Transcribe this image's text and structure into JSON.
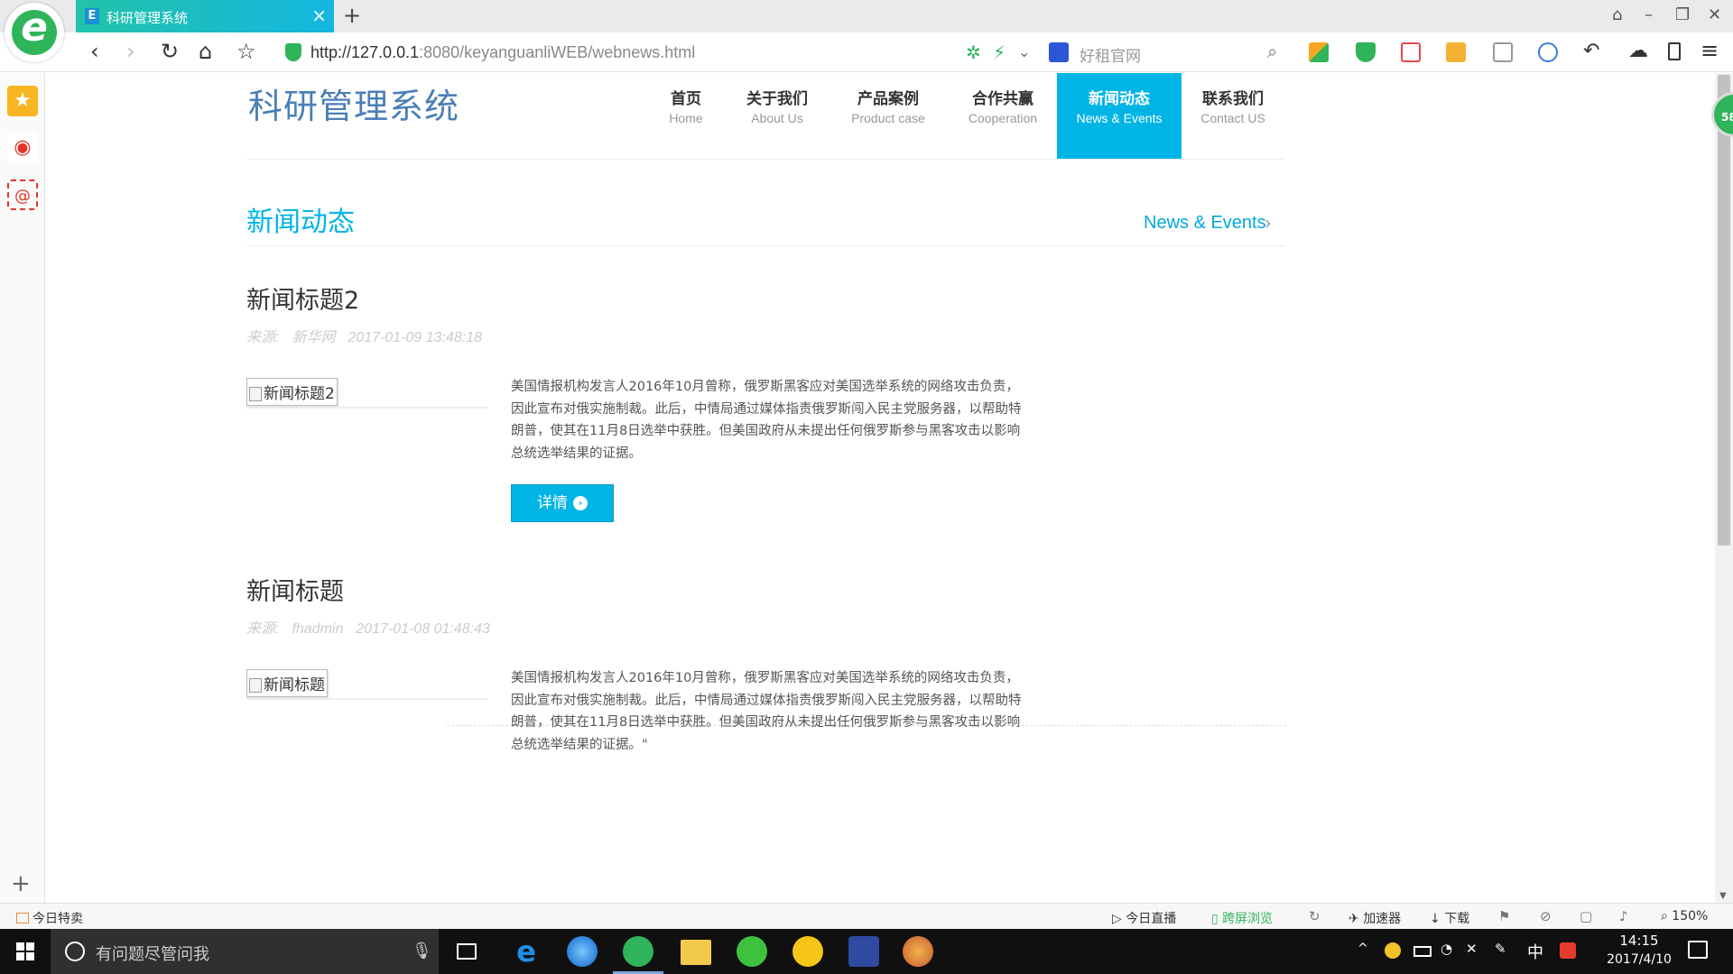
{
  "browser": {
    "tab_title": "科研管理系统",
    "tab_favicon": "E",
    "url_host": "http://127.0.0.1",
    "url_rest": ":8080/keyanguanliWEB/webnews.html",
    "search_placeholder": "好租官网"
  },
  "site": {
    "title": "科研管理系统",
    "nav": [
      {
        "cn": "首页",
        "en": "Home"
      },
      {
        "cn": "关于我们",
        "en": "About Us"
      },
      {
        "cn": "产品案例",
        "en": "Product case"
      },
      {
        "cn": "合作共赢",
        "en": "Cooperation"
      },
      {
        "cn": "新闻动态",
        "en": "News & Events"
      },
      {
        "cn": "联系我们",
        "en": "Contact US"
      }
    ],
    "active_nav": "新闻动态",
    "accent_color": "#00b4e6"
  },
  "section": {
    "title": "新闻动态",
    "title_en": "News & Events"
  },
  "news": [
    {
      "title": "新闻标题2",
      "source_label": "来源:",
      "source": "新华网",
      "time": "2017-01-09 13:48:18",
      "image_alt": "新闻标题2",
      "body": "美国情报机构发言人2016年10月曾称，俄罗斯黑客应对美国选举系统的网络攻击负责，因此宣布对俄实施制裁。此后，中情局通过媒体指责俄罗斯闯入民主党服务器，以帮助特朗普，使其在11月8日选举中获胜。但美国政府从未提出任何俄罗斯参与黑客攻击以影响总统选举结果的证据。",
      "button": "详情"
    },
    {
      "title": "新闻标题",
      "source_label": "来源:",
      "source": "fhadmin",
      "time": "2017-01-08 01:48:43",
      "image_alt": "新闻标题",
      "body": "美国情报机构发言人2016年10月曾称，俄罗斯黑客应对美国选举系统的网络攻击负责，因此宣布对俄实施制裁。此后，中情局通过媒体指责俄罗斯闯入民主党服务器，以帮助特朗普，使其在11月8日选举中获胜。但美国政府从未提出任何俄罗斯参与黑客攻击以影响总统选举结果的证据。\""
    }
  ],
  "side_badge": "58",
  "statusbar": {
    "deals": "今日特卖",
    "live": "今日直播",
    "cross_screen": "跨屏浏览",
    "accelerator": "加速器",
    "download": "下载",
    "zoom": "150%"
  },
  "taskbar": {
    "search_text": "有问题尽管问我",
    "ime": "中",
    "time": "14:15",
    "date": "2017/4/10"
  }
}
